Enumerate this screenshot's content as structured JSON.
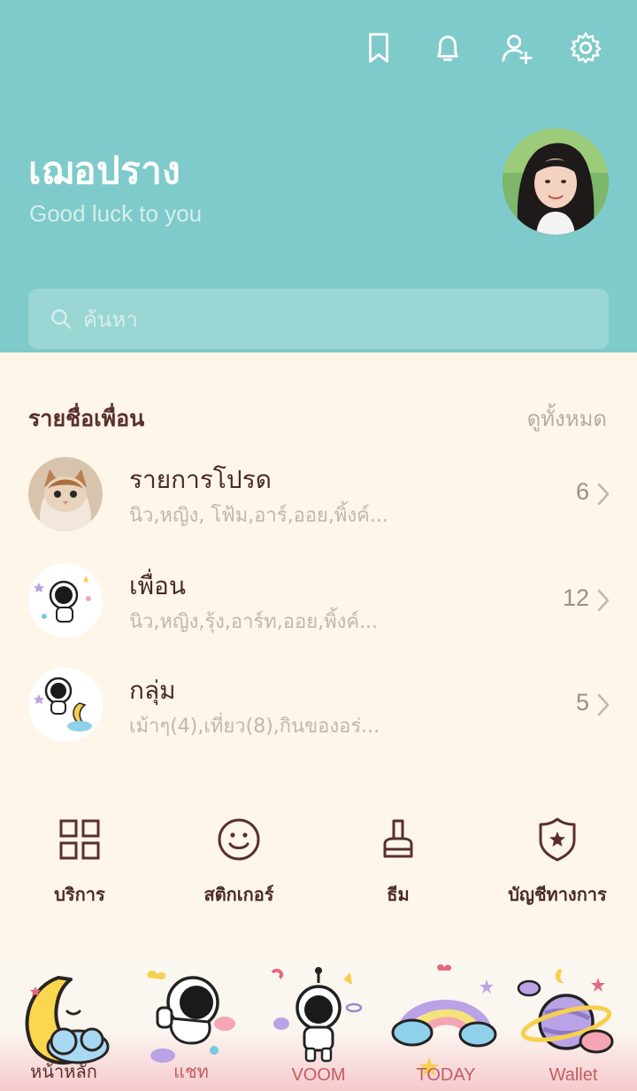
{
  "header": {
    "icons": [
      "bookmark-icon",
      "bell-icon",
      "add-friend-icon",
      "gear-icon"
    ],
    "profile": {
      "name": "เฌอปราง",
      "status": "Good luck to you"
    },
    "search": {
      "placeholder": "ค้นหา"
    },
    "colors": {
      "header_bg": "#7fcaca",
      "page_bg": "#fdf6e9",
      "text_dark": "#4b2a26"
    }
  },
  "friends": {
    "title": "รายชื่อเพื่อน",
    "see_all": "ดูทั้งหมด",
    "rows": [
      {
        "title": "รายการโปรด",
        "sub": "นิว,หญิง, โฟ้ม,อาร์,ออย,พิ้งค์...",
        "count": "6"
      },
      {
        "title": "เพื่อน",
        "sub": "นิว,หญิง,รุ้ง,อาร์ท,ออย,พิ้งค์...",
        "count": "12"
      },
      {
        "title": "กลุ่ม",
        "sub": "เม้าๆ(4),เที่ยว(8),กินของอร่...",
        "count": "5"
      }
    ]
  },
  "actions": [
    {
      "label": "บริการ",
      "icon": "grid-icon"
    },
    {
      "label": "สติกเกอร์",
      "icon": "smiley-icon"
    },
    {
      "label": "ธีม",
      "icon": "brush-icon"
    },
    {
      "label": "บัญชีทางการ",
      "icon": "shield-star-icon"
    }
  ],
  "bottom_nav": [
    {
      "label": "หน้าหลัก",
      "icon": "moon-icon",
      "active": true
    },
    {
      "label": "แชท",
      "icon": "astronaut-icon"
    },
    {
      "label": "VOOM",
      "icon": "astronaut-standing-icon"
    },
    {
      "label": "TODAY",
      "icon": "rainbow-icon"
    },
    {
      "label": "Wallet",
      "icon": "planet-icon"
    }
  ]
}
